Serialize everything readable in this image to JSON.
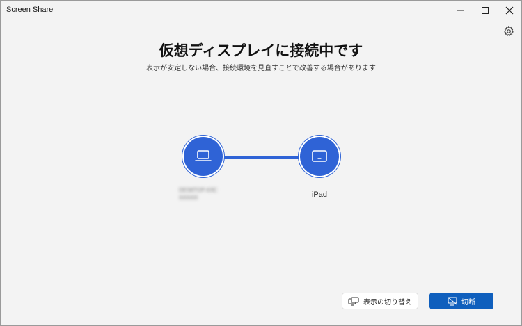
{
  "window": {
    "title": "Screen Share"
  },
  "main": {
    "heading": "仮想ディスプレイに接続中です",
    "subheading": "表示が安定しない場合、接続環境を見直すことで改善する場合があります"
  },
  "devices": {
    "pc": {
      "name_line1": "DESKTOP-XXC",
      "name_line2": "XXXXX"
    },
    "ipad": {
      "name": "iPad"
    }
  },
  "buttons": {
    "switch_display": "表示の切り替え",
    "disconnect": "切断"
  },
  "colors": {
    "accent": "#2f63d6",
    "disconnect_bg": "#0f5fbd",
    "background": "#f3f3f3"
  },
  "icons": {
    "minimize": "minimize-icon",
    "maximize": "maximize-icon",
    "close": "close-icon",
    "settings": "gear-icon",
    "laptop": "laptop-icon",
    "tablet": "tablet-icon",
    "switch_display": "display-switch-icon",
    "disconnect": "disconnect-display-icon"
  }
}
